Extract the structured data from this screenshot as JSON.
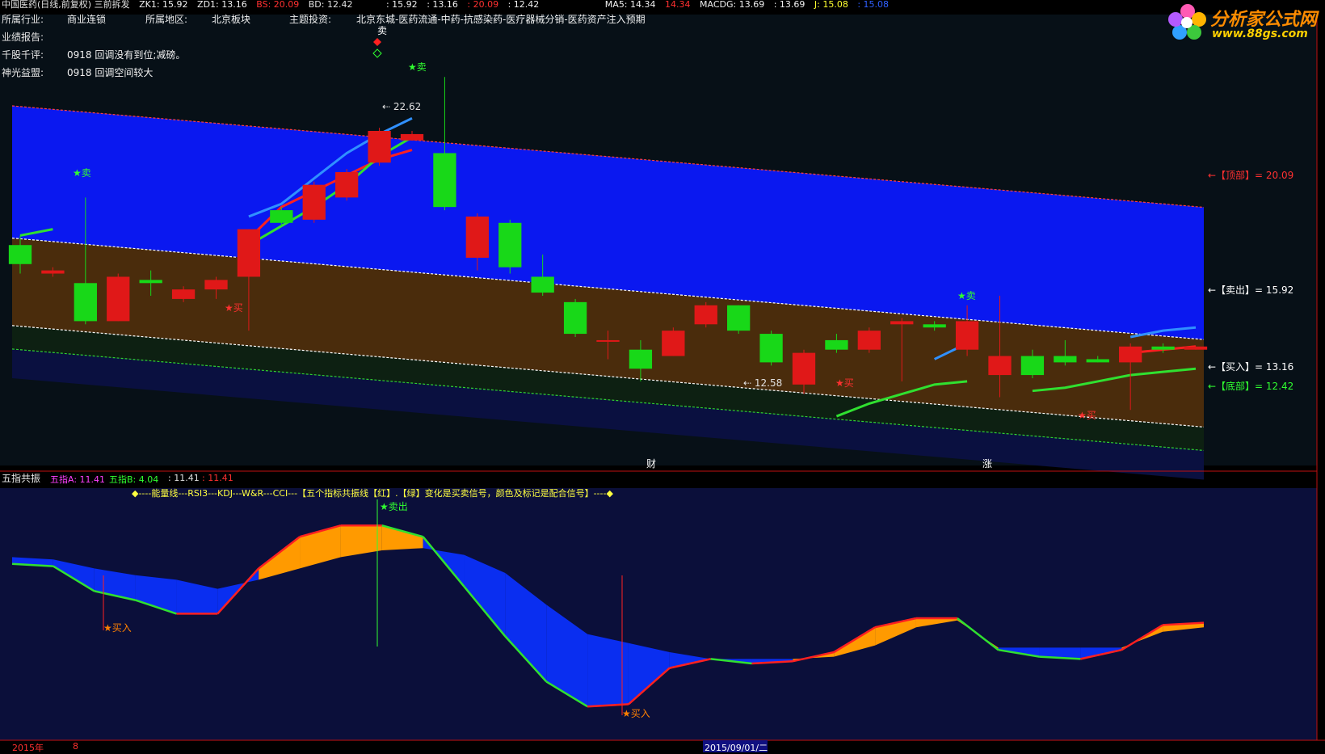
{
  "header": {
    "title": "中国医药(日线,前复权) 三前拆发",
    "zk1": "ZK1: 15.92",
    "zd1": "ZD1: 13.16",
    "bs": "BS: 20.09",
    "bd": "BD: 12.42",
    "mid1": ": 15.92",
    "mid2": ": 13.16",
    "mid3": ": 20.09",
    "mid4": ": 12.42",
    "ma5": "MA5: 14.34",
    "ma5b": "14.34",
    "macdg": "MACDG: 13.69",
    "macdg2": ": 13.69",
    "j": "J: 15.08",
    "j2": ": 15.08"
  },
  "info": {
    "industry_label": "所属行业:",
    "industry_value": "商业连锁",
    "region_label": "所属地区:",
    "region_value": "北京板块",
    "theme_label": "主题投资:",
    "theme_value": "北京东城-医药流通-中药-抗感染药-医疗器械分销-医药资产注入预期",
    "report_label": "业绩报告:",
    "comment_label": "千股千评:",
    "comment_value": "0918  回调没有到位;减磅。",
    "alliance_label": "神光益盟:",
    "alliance_value": "0918  回调空间较大"
  },
  "logo": {
    "name": "分析家公式网",
    "url_text": "www.88gs.com"
  },
  "levels": {
    "top": "←【顶部】= 20.09",
    "sell": "←【卖出】= 15.92",
    "buy": "←【买入】= 13.16",
    "bottom": "←【底部】= 12.42"
  },
  "annotations": {
    "peak": "22.62",
    "trough": "12.58",
    "sell": "卖",
    "buy": "买",
    "sell_out": "卖出",
    "buy_in": "买入",
    "cai": "财",
    "zhang": "涨"
  },
  "lower": {
    "title": "五指共振",
    "a_label": "五指A: 11.41",
    "b_label": "五指B: 4.04",
    "v1": ": 11.41",
    "v2": ": 11.41",
    "desc": "◆----能量线---RSI3---KDJ---W&R---CCI---【五个指标共振线【红】.【绿】变化是买卖信号，颜色及标记是配合信号】----◆"
  },
  "footer": {
    "year": "2015年",
    "month": "8",
    "date": "2015/09/01/二"
  },
  "colors": {
    "up": "#e01818",
    "down": "#18d818",
    "blue_band": "#0a18f0",
    "brown_band": "#4a2c0c",
    "orange_fill": "#ff9a00",
    "lower_blue_fill": "#0a2ef0"
  },
  "chart_data": [
    {
      "type": "candlestick",
      "title": "",
      "ylim": [
        10.5,
        23.5
      ],
      "levels": {
        "top": 20.09,
        "sell": 15.92,
        "buy": 13.16,
        "bottom": 12.42
      },
      "candles": [
        {
          "o": 17.3,
          "c": 16.7,
          "h": 17.6,
          "l": 16.4
        },
        {
          "o": 16.4,
          "c": 16.5,
          "h": 16.6,
          "l": 16.3
        },
        {
          "o": 16.1,
          "c": 14.9,
          "h": 18.8,
          "l": 14.8
        },
        {
          "o": 14.9,
          "c": 16.3,
          "h": 16.4,
          "l": 14.9
        },
        {
          "o": 16.2,
          "c": 16.1,
          "h": 16.5,
          "l": 15.7
        },
        {
          "o": 15.6,
          "c": 15.9,
          "h": 16.0,
          "l": 15.5
        },
        {
          "o": 15.9,
          "c": 16.2,
          "h": 16.3,
          "l": 15.6
        },
        {
          "o": 16.3,
          "c": 17.8,
          "h": 17.8,
          "l": 14.6
        },
        {
          "o": 18.4,
          "c": 18.0,
          "h": 18.5,
          "l": 17.9
        },
        {
          "o": 18.1,
          "c": 19.2,
          "h": 19.3,
          "l": 18.0
        },
        {
          "o": 18.8,
          "c": 19.6,
          "h": 19.7,
          "l": 18.7
        },
        {
          "o": 19.9,
          "c": 20.9,
          "h": 21.0,
          "l": 19.8
        },
        {
          "o": 20.6,
          "c": 20.8,
          "h": 20.9,
          "l": 20.6
        },
        {
          "o": 20.2,
          "c": 18.5,
          "h": 22.6,
          "l": 18.4
        },
        {
          "o": 16.9,
          "c": 18.2,
          "h": 18.3,
          "l": 16.5
        },
        {
          "o": 18.0,
          "c": 16.6,
          "h": 18.1,
          "l": 16.4
        },
        {
          "o": 16.3,
          "c": 15.8,
          "h": 17.0,
          "l": 15.7
        },
        {
          "o": 15.5,
          "c": 14.5,
          "h": 15.6,
          "l": 14.4
        },
        {
          "o": 14.3,
          "c": 14.3,
          "h": 14.6,
          "l": 13.7
        },
        {
          "o": 14.0,
          "c": 13.4,
          "h": 14.3,
          "l": 13.0
        },
        {
          "o": 13.8,
          "c": 14.6,
          "h": 14.7,
          "l": 13.8
        },
        {
          "o": 14.8,
          "c": 15.4,
          "h": 15.5,
          "l": 14.7
        },
        {
          "o": 15.4,
          "c": 14.6,
          "h": 15.4,
          "l": 14.5
        },
        {
          "o": 14.5,
          "c": 13.6,
          "h": 14.6,
          "l": 13.5
        },
        {
          "o": 12.9,
          "c": 13.9,
          "h": 14.0,
          "l": 12.6
        },
        {
          "o": 14.3,
          "c": 14.0,
          "h": 14.5,
          "l": 13.9
        },
        {
          "o": 14.0,
          "c": 14.6,
          "h": 14.7,
          "l": 13.9
        },
        {
          "o": 14.8,
          "c": 14.9,
          "h": 15.0,
          "l": 13.0
        },
        {
          "o": 14.8,
          "c": 14.7,
          "h": 14.9,
          "l": 14.6
        },
        {
          "o": 14.0,
          "c": 14.9,
          "h": 15.4,
          "l": 13.8
        },
        {
          "o": 13.2,
          "c": 13.8,
          "h": 15.7,
          "l": 12.5
        },
        {
          "o": 13.8,
          "c": 13.2,
          "h": 14.0,
          "l": 13.1
        },
        {
          "o": 13.8,
          "c": 13.6,
          "h": 14.3,
          "l": 13.5
        },
        {
          "o": 13.7,
          "c": 13.6,
          "h": 13.8,
          "l": 13.6
        },
        {
          "o": 13.6,
          "c": 14.1,
          "h": 14.2,
          "l": 12.1
        },
        {
          "o": 14.1,
          "c": 14.0,
          "h": 14.2,
          "l": 13.9
        },
        {
          "o": 14.0,
          "c": 14.1,
          "h": 14.1,
          "l": 14.0
        }
      ],
      "line_red": [
        17.4,
        null,
        null,
        null,
        null,
        null,
        null,
        17.5,
        18.5,
        19.0,
        19.5,
        20.0,
        20.3,
        null,
        null,
        null,
        null,
        null,
        null,
        null,
        null,
        null,
        null,
        null,
        null,
        null,
        null,
        null,
        null,
        null,
        null,
        null,
        null,
        null,
        13.9,
        14.0,
        14.1
      ],
      "line_blue": [
        null,
        null,
        null,
        null,
        null,
        null,
        null,
        18.2,
        18.6,
        19.4,
        20.2,
        20.8,
        21.3,
        null,
        null,
        null,
        null,
        null,
        null,
        null,
        null,
        null,
        null,
        null,
        null,
        null,
        null,
        null,
        13.7,
        14.2,
        null,
        null,
        null,
        null,
        14.4,
        14.6,
        14.7
      ],
      "line_green": [
        17.6,
        17.8,
        null,
        null,
        null,
        null,
        null,
        17.3,
        17.9,
        18.5,
        19.2,
        20.1,
        20.7,
        null,
        null,
        null,
        null,
        null,
        null,
        null,
        null,
        null,
        null,
        null,
        null,
        11.9,
        12.3,
        12.6,
        12.9,
        13.0,
        null,
        12.7,
        12.8,
        13.0,
        13.2,
        13.3,
        13.4
      ]
    },
    {
      "type": "area",
      "title": "五指共振",
      "ylim": [
        0,
        100
      ],
      "series": [
        {
          "name": "五指A",
          "values": [
            74,
            73,
            62,
            58,
            52,
            52,
            72,
            86,
            91,
            91,
            86,
            64,
            42,
            22,
            11,
            12,
            28,
            32,
            30,
            31,
            35,
            46,
            50,
            50,
            36,
            33,
            32,
            36,
            47,
            48
          ]
        },
        {
          "name": "五指B",
          "values": [
            77,
            76,
            72,
            69,
            67,
            63,
            67,
            72,
            77,
            80,
            81,
            78,
            70,
            56,
            43,
            39,
            35,
            32,
            32,
            32,
            33,
            38,
            46,
            49,
            37,
            37,
            37,
            37,
            44,
            46
          ]
        }
      ]
    }
  ]
}
